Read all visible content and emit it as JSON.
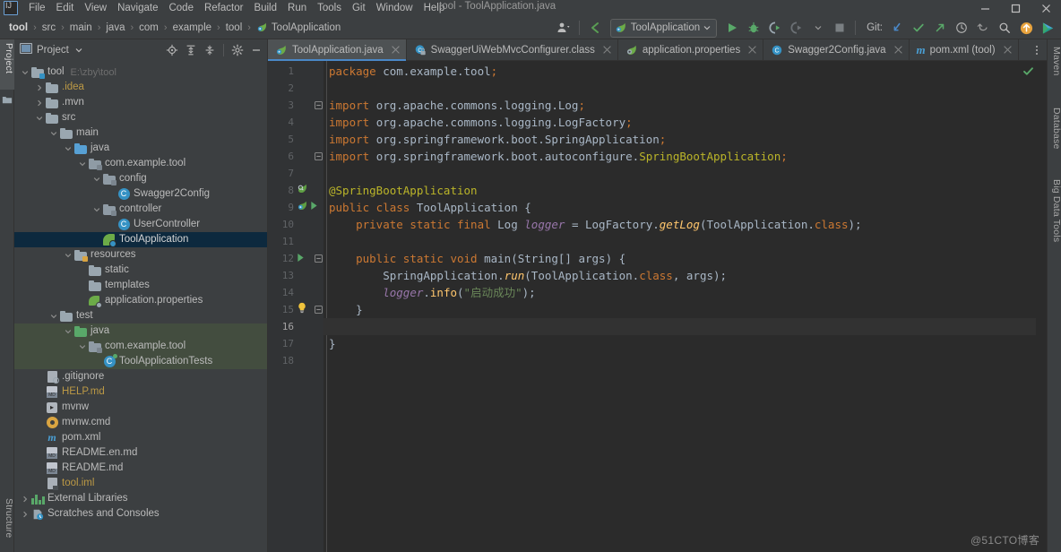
{
  "window": {
    "title": "tool - ToolApplication.java",
    "controls": [
      "minimize",
      "maximize",
      "close"
    ]
  },
  "menu": {
    "logo": "intellij-idea-logo",
    "items": [
      "File",
      "Edit",
      "View",
      "Navigate",
      "Code",
      "Refactor",
      "Build",
      "Run",
      "Tools",
      "Git",
      "Window",
      "Help"
    ]
  },
  "breadcrumb": {
    "items": [
      "tool",
      "src",
      "main",
      "java",
      "com",
      "example",
      "tool",
      "ToolApplication"
    ],
    "leaf_icon": "spring-boot-class-icon"
  },
  "toolbar": {
    "avatar_icon": "user-avatar-icon",
    "back_icon": "navigate-back-icon",
    "run_config": {
      "icon": "spring-boot-run-config-icon",
      "label": "ToolApplication",
      "chevron": "chevron-down-icon"
    },
    "run_label": "Run",
    "debug_label": "Debug",
    "run_with_coverage_label": "Run with Coverage",
    "profile_label": "Profile",
    "stop_label": "Stop",
    "git_label": "Git:",
    "update_project_label": "Update Project",
    "commit_label": "Commit",
    "push_label": "Push",
    "history_label": "History",
    "rollback_label": "Rollback",
    "search_everywhere_label": "Search Everywhere",
    "ide_update_label": "IDE and Plugin Updates",
    "ide_logo_label": "IDE Logo"
  },
  "left_strip": {
    "tabs": [
      {
        "label": "Project",
        "active": true
      },
      {
        "label": "Structure",
        "active": false
      }
    ]
  },
  "right_strip": {
    "tabs": [
      "Maven",
      "Database",
      "Big Data Tools"
    ]
  },
  "project_panel": {
    "title": "Project",
    "chevron": "chevron-down-icon",
    "tools": [
      "locate-file-icon",
      "expand-all-icon",
      "collapse-all-icon",
      "settings-gear-icon",
      "hide-panel-icon"
    ],
    "tree": [
      {
        "label": "tool",
        "sub": "E:\\zby\\tool",
        "depth": 0,
        "arrow": "down",
        "icon": "module-folder",
        "style": ""
      },
      {
        "label": ".idea",
        "sub": "",
        "depth": 1,
        "arrow": "right",
        "icon": "folder-grey",
        "style": "yellowfile"
      },
      {
        "label": ".mvn",
        "sub": "",
        "depth": 1,
        "arrow": "right",
        "icon": "folder-grey",
        "style": ""
      },
      {
        "label": "src",
        "sub": "",
        "depth": 1,
        "arrow": "down",
        "icon": "folder-grey",
        "style": ""
      },
      {
        "label": "main",
        "sub": "",
        "depth": 2,
        "arrow": "down",
        "icon": "folder-grey",
        "style": ""
      },
      {
        "label": "java",
        "sub": "",
        "depth": 3,
        "arrow": "down",
        "icon": "folder-blue",
        "style": ""
      },
      {
        "label": "com.example.tool",
        "sub": "",
        "depth": 4,
        "arrow": "down",
        "icon": "package",
        "style": ""
      },
      {
        "label": "config",
        "sub": "",
        "depth": 5,
        "arrow": "down",
        "icon": "package",
        "style": ""
      },
      {
        "label": "Swagger2Config",
        "sub": "",
        "depth": 6,
        "arrow": "none",
        "icon": "java-class",
        "style": ""
      },
      {
        "label": "controller",
        "sub": "",
        "depth": 5,
        "arrow": "down",
        "icon": "package",
        "style": ""
      },
      {
        "label": "UserController",
        "sub": "",
        "depth": 6,
        "arrow": "none",
        "icon": "java-class",
        "style": ""
      },
      {
        "label": "ToolApplication",
        "sub": "",
        "depth": 5,
        "arrow": "none",
        "icon": "spring-class",
        "style": "selected"
      },
      {
        "label": "resources",
        "sub": "",
        "depth": 3,
        "arrow": "down",
        "icon": "resources-folder",
        "style": ""
      },
      {
        "label": "static",
        "sub": "",
        "depth": 4,
        "arrow": "none",
        "icon": "folder-grey",
        "style": ""
      },
      {
        "label": "templates",
        "sub": "",
        "depth": 4,
        "arrow": "none",
        "icon": "folder-grey",
        "style": ""
      },
      {
        "label": "application.properties",
        "sub": "",
        "depth": 4,
        "arrow": "none",
        "icon": "spring-props",
        "style": ""
      },
      {
        "label": "test",
        "sub": "",
        "depth": 2,
        "arrow": "down",
        "icon": "folder-grey",
        "style": ""
      },
      {
        "label": "java",
        "sub": "",
        "depth": 3,
        "arrow": "down",
        "icon": "folder-green",
        "style": "srcroot-green"
      },
      {
        "label": "com.example.tool",
        "sub": "",
        "depth": 4,
        "arrow": "down",
        "icon": "package",
        "style": "srcroot-green"
      },
      {
        "label": "ToolApplicationTests",
        "sub": "",
        "depth": 5,
        "arrow": "none",
        "icon": "test-class",
        "style": "srcroot-green"
      },
      {
        "label": ".gitignore",
        "sub": "",
        "depth": 1,
        "arrow": "none",
        "icon": "gitignore-file",
        "style": ""
      },
      {
        "label": "HELP.md",
        "sub": "",
        "depth": 1,
        "arrow": "none",
        "icon": "markdown-file",
        "style": "yellowfile"
      },
      {
        "label": "mvnw",
        "sub": "",
        "depth": 1,
        "arrow": "none",
        "icon": "script-file",
        "style": ""
      },
      {
        "label": "mvnw.cmd",
        "sub": "",
        "depth": 1,
        "arrow": "none",
        "icon": "cmd-file",
        "style": ""
      },
      {
        "label": "pom.xml",
        "sub": "",
        "depth": 1,
        "arrow": "none",
        "icon": "maven-file",
        "style": ""
      },
      {
        "label": "README.en.md",
        "sub": "",
        "depth": 1,
        "arrow": "none",
        "icon": "markdown-file",
        "style": ""
      },
      {
        "label": "README.md",
        "sub": "",
        "depth": 1,
        "arrow": "none",
        "icon": "markdown-file",
        "style": ""
      },
      {
        "label": "tool.iml",
        "sub": "",
        "depth": 1,
        "arrow": "none",
        "icon": "iml-file",
        "style": "yellowfile"
      },
      {
        "label": "External Libraries",
        "sub": "",
        "depth": 0,
        "arrow": "right",
        "icon": "libraries",
        "style": ""
      },
      {
        "label": "Scratches and Consoles",
        "sub": "",
        "depth": 0,
        "arrow": "right",
        "icon": "scratches",
        "style": ""
      }
    ]
  },
  "editor": {
    "tabs": [
      {
        "label": "ToolApplication.java",
        "icon": "spring-boot-class-icon",
        "active": true
      },
      {
        "label": "SwaggerUiWebMvcConfigurer.class",
        "icon": "compiled-class-icon",
        "active": false
      },
      {
        "label": "application.properties",
        "icon": "spring-properties-icon",
        "active": false
      },
      {
        "label": "Swagger2Config.java",
        "icon": "java-class-icon",
        "active": false
      },
      {
        "label": "pom.xml (tool)",
        "icon": "maven-icon",
        "active": false
      }
    ],
    "overflow_icon": "tab-list-icon",
    "inspection_status": "ok-check-icon",
    "caret_line": 16,
    "lines": [
      {
        "n": 1,
        "tokens": [
          {
            "t": "package ",
            "c": "kw"
          },
          {
            "t": "com.example.tool",
            "c": "plain"
          },
          {
            "t": ";",
            "c": "semi"
          }
        ],
        "indent": 0
      },
      {
        "n": 2,
        "tokens": [],
        "indent": 0
      },
      {
        "n": 3,
        "tokens": [
          {
            "t": "import ",
            "c": "kw"
          },
          {
            "t": "org.apache.commons.logging.Log",
            "c": "plain"
          },
          {
            "t": ";",
            "c": "semi"
          }
        ],
        "indent": 0,
        "fold": "minus"
      },
      {
        "n": 4,
        "tokens": [
          {
            "t": "import ",
            "c": "kw"
          },
          {
            "t": "org.apache.commons.logging.LogFactory",
            "c": "plain"
          },
          {
            "t": ";",
            "c": "semi"
          }
        ],
        "indent": 0
      },
      {
        "n": 5,
        "tokens": [
          {
            "t": "import ",
            "c": "kw"
          },
          {
            "t": "org.springframework.boot.SpringApplication",
            "c": "plain"
          },
          {
            "t": ";",
            "c": "semi"
          }
        ],
        "indent": 0
      },
      {
        "n": 6,
        "tokens": [
          {
            "t": "import ",
            "c": "kw"
          },
          {
            "t": "org.springframework.boot.autoconfigure.",
            "c": "plain"
          },
          {
            "t": "SpringBootApplication",
            "c": "ann"
          },
          {
            "t": ";",
            "c": "semi"
          }
        ],
        "indent": 0,
        "fold": "minus"
      },
      {
        "n": 7,
        "tokens": [],
        "indent": 0
      },
      {
        "n": 8,
        "tokens": [
          {
            "t": "@SpringBootApplication",
            "c": "ann"
          }
        ],
        "indent": 0,
        "gutter": "spring-bean-icon"
      },
      {
        "n": 9,
        "tokens": [
          {
            "t": "public class ",
            "c": "kw"
          },
          {
            "t": "ToolApplication {",
            "c": "plain"
          }
        ],
        "indent": 0,
        "gutter": "spring-boot-run-icon"
      },
      {
        "n": 10,
        "tokens": [
          {
            "t": "private static final ",
            "c": "kw"
          },
          {
            "t": "Log ",
            "c": "plain"
          },
          {
            "t": "logger",
            "c": "fld"
          },
          {
            "t": " = LogFactory.",
            "c": "plain"
          },
          {
            "t": "getLog",
            "c": "mthi"
          },
          {
            "t": "(ToolApplication.",
            "c": "plain"
          },
          {
            "t": "class",
            "c": "kw"
          },
          {
            "t": ");",
            "c": "plain"
          }
        ],
        "indent": 1
      },
      {
        "n": 11,
        "tokens": [],
        "indent": 0
      },
      {
        "n": 12,
        "tokens": [
          {
            "t": "public static void ",
            "c": "kw"
          },
          {
            "t": "main",
            "c": "plain"
          },
          {
            "t": "(String[] args) {",
            "c": "plain"
          }
        ],
        "indent": 1,
        "gutter": "run-method-icon",
        "fold": "minus"
      },
      {
        "n": 13,
        "tokens": [
          {
            "t": "SpringApplication.",
            "c": "plain"
          },
          {
            "t": "run",
            "c": "mthi"
          },
          {
            "t": "(ToolApplication.",
            "c": "plain"
          },
          {
            "t": "class",
            "c": "kw"
          },
          {
            "t": ", args);",
            "c": "plain"
          }
        ],
        "indent": 2
      },
      {
        "n": 14,
        "tokens": [
          {
            "t": "logger",
            "c": "fld"
          },
          {
            "t": ".",
            "c": "plain"
          },
          {
            "t": "info",
            "c": "mth"
          },
          {
            "t": "(",
            "c": "plain"
          },
          {
            "t": "\"启动成功\"",
            "c": "str"
          },
          {
            "t": ");",
            "c": "plain"
          }
        ],
        "indent": 2
      },
      {
        "n": 15,
        "tokens": [
          {
            "t": "}",
            "c": "plain"
          }
        ],
        "indent": 1,
        "fold": "minus",
        "gutter": "intention-bulb-icon"
      },
      {
        "n": 16,
        "tokens": [],
        "indent": 0
      },
      {
        "n": 17,
        "tokens": [
          {
            "t": "}",
            "c": "plain"
          }
        ],
        "indent": 0
      },
      {
        "n": 18,
        "tokens": [],
        "indent": 0
      }
    ]
  },
  "watermark": "@51CTO博客",
  "colors": {
    "bg_panel": "#3c3f41",
    "bg_editor": "#2b2b2b",
    "bg_gutter": "#313335",
    "accent_blue": "#4a88c7",
    "selection": "#0d293e",
    "src_root_green": "#556e3d",
    "keyword_orange": "#cc7832",
    "string_green": "#6a8759",
    "annotation_yellow": "#bbb529",
    "field_purple": "#9876aa",
    "method_gold": "#ffc66d",
    "text_default": "#a9b7c6",
    "ignored_yellow": "#bc9945"
  }
}
